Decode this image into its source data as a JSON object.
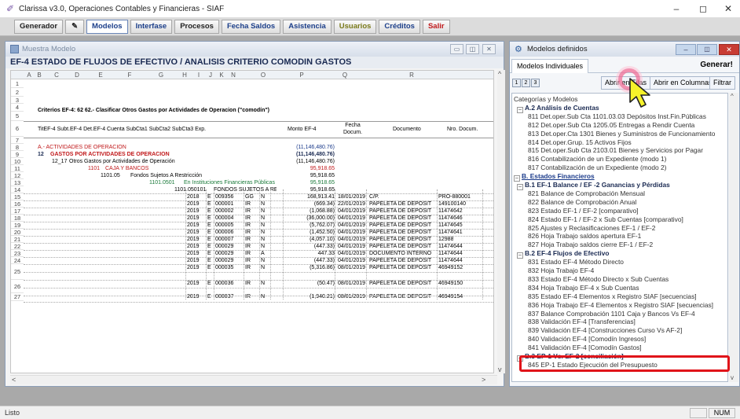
{
  "app": {
    "title": "Clarissa v3.0, Operaciones Contables y Financieras - SIAF",
    "window_controls": {
      "minimize": "–",
      "maximize": "◻",
      "close": "✕"
    }
  },
  "toolbar": {
    "items": [
      "Generador",
      "Modelos",
      "Interfase",
      "Procesos",
      "Fecha Saldos",
      "Asistencia",
      "Usuarios",
      "Créditos",
      "Salir"
    ]
  },
  "muestra": {
    "caption": "Muestra Modelo",
    "heading": "EF-4 ESTADO DE FLUJOS DE EFECTIVO / ANALISIS CRITERIO COMODIN GASTOS",
    "columns": [
      "A",
      "B",
      "C",
      "D",
      "E",
      "F",
      "G",
      "H",
      "I",
      "J",
      "K",
      "N",
      "O",
      "P",
      "Q",
      "R"
    ],
    "report_title": "EF-4 ESTADO DE FLUJOS DE EFECTIVO AL 30-JUN-2019 / ANALISIS CR",
    "criteria": "Criterios EF-4: 62 62.- Clasificar Otros Gastos por Actividades de Operacion (\"comodín\")",
    "header_left": "TitEF-4 Subt.EF-4 Det.EF-4 Cuenta SubCta1 SubCta2 SubCta3 Exp.",
    "header_monto": "Monto EF-4",
    "header_fecha": "Fecha Docum.",
    "header_documento": "Documento",
    "header_nro": "Nro. Docum.",
    "rows": {
      "r8": {
        "label": "A.- ACTIVIDADES DE OPERACION",
        "monto": "(11,146,480.76)"
      },
      "r9": {
        "code": "12",
        "label": "GASTOS POR ACTIVIDADES DE OPERACION",
        "monto": "(11,146,480.76)"
      },
      "r10": {
        "code": "12_17",
        "label": "Otros Gastos por Actividades de Operación",
        "monto": "(11,146,480.76)"
      },
      "r11": {
        "code": "1101",
        "label": "CAJA Y BANCOS",
        "monto": "95,918.65"
      },
      "r12": {
        "code": "1101.05",
        "label": "Fondos Sujetos A Restricción",
        "monto": "95,918.65"
      },
      "r13": {
        "code": "1101.0501",
        "label": "En Instituciones Financieras Públicas",
        "monto": "95,918.65"
      },
      "r14": {
        "code": "1101.050101",
        "label": "FONDOS SUJETOS A RESTRIC",
        "monto": "95,918.65"
      }
    },
    "detail_rows": [
      {
        "row": "15",
        "y": "2018",
        "e": "E",
        "exp": "009356",
        "k": "GG",
        "n": "N",
        "monto": "168,913.41",
        "fecha": "18/01/2019",
        "doc": "C/P.",
        "nro": "PRO-880001"
      },
      {
        "row": "16",
        "y": "2019",
        "e": "E",
        "exp": "000001",
        "k": "IR",
        "n": "N",
        "monto": "(669.34)",
        "fecha": "22/01/2019",
        "doc": "PAPELETA DE DEPOSIT",
        "nro": "149100140"
      },
      {
        "row": "17",
        "y": "2019",
        "e": "E",
        "exp": "000002",
        "k": "IR",
        "n": "N",
        "monto": "(1,068.88)",
        "fecha": "04/01/2019",
        "doc": "PAPELETA DE DEPOSIT",
        "nro": "11474642"
      },
      {
        "row": "18",
        "y": "2019",
        "e": "E",
        "exp": "000004",
        "k": "IR",
        "n": "N",
        "monto": "(36,000.00)",
        "fecha": "04/01/2019",
        "doc": "PAPELETA DE DEPOSIT",
        "nro": "11474646"
      },
      {
        "row": "19",
        "y": "2019",
        "e": "E",
        "exp": "000005",
        "k": "IR",
        "n": "N",
        "monto": "(5,762.07)",
        "fecha": "04/01/2019",
        "doc": "PAPELETA DE DEPOSIT",
        "nro": "11474645"
      },
      {
        "row": "20",
        "y": "2019",
        "e": "E",
        "exp": "000006",
        "k": "IR",
        "n": "N",
        "monto": "(1,452.50)",
        "fecha": "04/01/2019",
        "doc": "PAPELETA DE DEPOSIT",
        "nro": "11474641"
      },
      {
        "row": "21",
        "y": "2019",
        "e": "E",
        "exp": "000007",
        "k": "IR",
        "n": "N",
        "monto": "(4,057.10)",
        "fecha": "04/01/2019",
        "doc": "PAPELETA DE DEPOSIT",
        "nro": "12988"
      },
      {
        "row": "22",
        "y": "2019",
        "e": "E",
        "exp": "000029",
        "k": "IR",
        "n": "N",
        "monto": "(447.33)",
        "fecha": "04/01/2019",
        "doc": "PAPELETA DE DEPOSIT",
        "nro": "11474644"
      },
      {
        "row": "23",
        "y": "2019",
        "e": "E",
        "exp": "000029",
        "k": "IR",
        "n": "A",
        "monto": "447.33",
        "fecha": "04/01/2019",
        "doc": "DOCUMENTO INTERNO",
        "nro": "11474644"
      },
      {
        "row": "24",
        "y": "2019",
        "e": "E",
        "exp": "000029",
        "k": "IR",
        "n": "N",
        "monto": "(447.33)",
        "fecha": "04/01/2019",
        "doc": "PAPELETA DE DEPOSIT",
        "nro": "11474644"
      },
      {
        "row": "25",
        "y": "2019",
        "e": "E",
        "exp": "000035",
        "k": "IR",
        "n": "N",
        "monto": "(5,316.86)",
        "fecha": "08/01/2019",
        "doc": "PAPELETA DE DEPOSIT",
        "nro": "46949152"
      },
      {
        "row": "26",
        "y": "2019",
        "e": "E",
        "exp": "000036",
        "k": "IR",
        "n": "N",
        "monto": "(50.47)",
        "fecha": "08/01/2019",
        "doc": "PAPELETA DE DEPOSIT",
        "nro": "46949150"
      },
      {
        "row": "27",
        "y": "2019",
        "e": "E",
        "exp": "000037",
        "k": "IR",
        "n": "N",
        "monto": "(1,940.21)",
        "fecha": "08/01/2019",
        "doc": "PAPELETA DE DEPOSIT",
        "nro": "46949154"
      }
    ]
  },
  "modelos": {
    "caption": "Modelos definidos",
    "tab": "Modelos Individuales",
    "generar": "Generar!",
    "levels": [
      "1",
      "2",
      "3"
    ],
    "abrir_filas": "Abrir en Filas",
    "abrir_columnas": "Abrir en Columnas",
    "filtrar": "Filtrar",
    "tree": [
      {
        "t": "Categorías y Modelos",
        "cls": "",
        "i": 0
      },
      {
        "t": "A.2  Análisis de Cuentas",
        "cls": "b",
        "i": 1,
        "tog": "–"
      },
      {
        "t": "811  Det.oper.Sub Cta 1101.03.03 Depósitos Inst.Fin.Públicas",
        "cls": "",
        "i": 2
      },
      {
        "t": "812  Det.oper.Sub Cta 1205.05 Entregas a Rendir Cuenta",
        "cls": "",
        "i": 2
      },
      {
        "t": "813  Det.oper.Cta 1301 Bienes y Suministros de Funcionamiento",
        "cls": "",
        "i": 2
      },
      {
        "t": "814  Det.oper.Grup. 15 Activos Fijos",
        "cls": "",
        "i": 2
      },
      {
        "t": "815  Det.oper.Sub Cta 2103.01 Bienes y Servicios por Pagar",
        "cls": "",
        "i": 2
      },
      {
        "t": "816  Contabilización de un Expediente (modo 1)",
        "cls": "",
        "i": 2
      },
      {
        "t": "817  Contabilización de un Expediente (modo 2)",
        "cls": "",
        "i": 2
      },
      {
        "t": "B. Estados Financieros",
        "cls": "sec",
        "i": 0,
        "tog": "–"
      },
      {
        "t": "B.1  EF-1 Balance  /  EF -2 Ganancias y Pérdidas",
        "cls": "b",
        "i": 1,
        "tog": "–"
      },
      {
        "t": "821  Balance de Comprobación Mensual",
        "cls": "",
        "i": 2
      },
      {
        "t": "822  Balance de Comprobación Anual",
        "cls": "",
        "i": 2
      },
      {
        "t": "823  Estado EF-1 / EF-2  [comparativo]",
        "cls": "",
        "i": 2
      },
      {
        "t": "824  Estado EF-1 / EF-2 x Sub Cuentas  [comparativo]",
        "cls": "",
        "i": 2
      },
      {
        "t": "825  Ajustes y Reclasificaciones EF-1 / EF-2",
        "cls": "",
        "i": 2
      },
      {
        "t": "826  Hoja Trabajo saldos apertura EF-1",
        "cls": "",
        "i": 2
      },
      {
        "t": "827  Hoja Trabajo saldos cierre EF-1 / EF-2",
        "cls": "",
        "i": 2
      },
      {
        "t": "B.2  EF-4 Flujos de Efectivo",
        "cls": "b",
        "i": 1,
        "tog": "–"
      },
      {
        "t": "831  Estado EF-4  Método Directo",
        "cls": "",
        "i": 2
      },
      {
        "t": "832  Hoja Trabajo EF-4",
        "cls": "",
        "i": 2
      },
      {
        "t": "833  Estado EF-4  Método Directo x Sub Cuentas",
        "cls": "",
        "i": 2
      },
      {
        "t": "834  Hoja Trabajo EF-4 x Sub Cuentas",
        "cls": "",
        "i": 2
      },
      {
        "t": "835  Estado EF-4  Elementos x Registro SIAF  [secuencias]",
        "cls": "",
        "i": 2
      },
      {
        "t": "836  Hoja Trabajo EF-4  Elementos x Registro SIAF  [secuencias]",
        "cls": "",
        "i": 2
      },
      {
        "t": "837  Balance Comprobación 1101 Caja y Bancos Vs EF-4",
        "cls": "",
        "i": 2
      },
      {
        "t": "838  Validación EF-4  [Transferencias]",
        "cls": "",
        "i": 2
      },
      {
        "t": "839  Validación EF-4  [Construcciones Curso Vs AF-2]",
        "cls": "",
        "i": 2
      },
      {
        "t": "840  Validación EF-4  [Comodín Ingresos]",
        "cls": "",
        "i": 2
      },
      {
        "t": "841  Validación EF-4  [Comodín Gastos]",
        "cls": "",
        "i": 2
      },
      {
        "t": "B.3  EP-1 Vs. EF-2  [conciliación]",
        "cls": "b",
        "i": 1,
        "tog": "–"
      },
      {
        "t": "845  EP-1 Estado Ejecución del Presupuesto",
        "cls": "",
        "i": 2
      }
    ]
  },
  "status": {
    "text": "Listo",
    "num": "NUM"
  }
}
